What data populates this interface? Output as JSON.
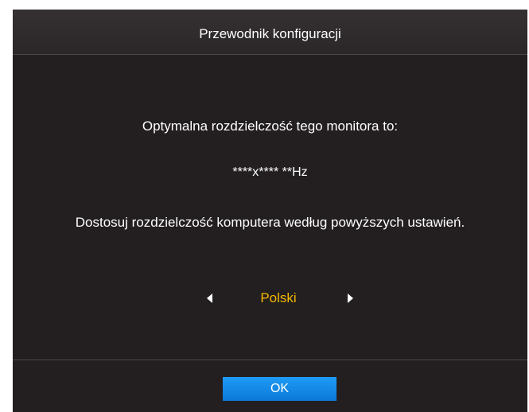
{
  "dialog": {
    "title": "Przewodnik konfiguracji",
    "line1": "Optymalna rozdzielczość tego monitora to:",
    "resolution": "****x**** **Hz",
    "line3": "Dostosuj rozdzielczość komputera według powyższych ustawień.",
    "language": "Polski",
    "ok_label": "OK"
  },
  "colors": {
    "background": "#231f20",
    "accent_text": "#f5b800",
    "button": "#1488e8"
  },
  "icons": {
    "prev": "triangle-left-icon",
    "next": "triangle-right-icon"
  }
}
